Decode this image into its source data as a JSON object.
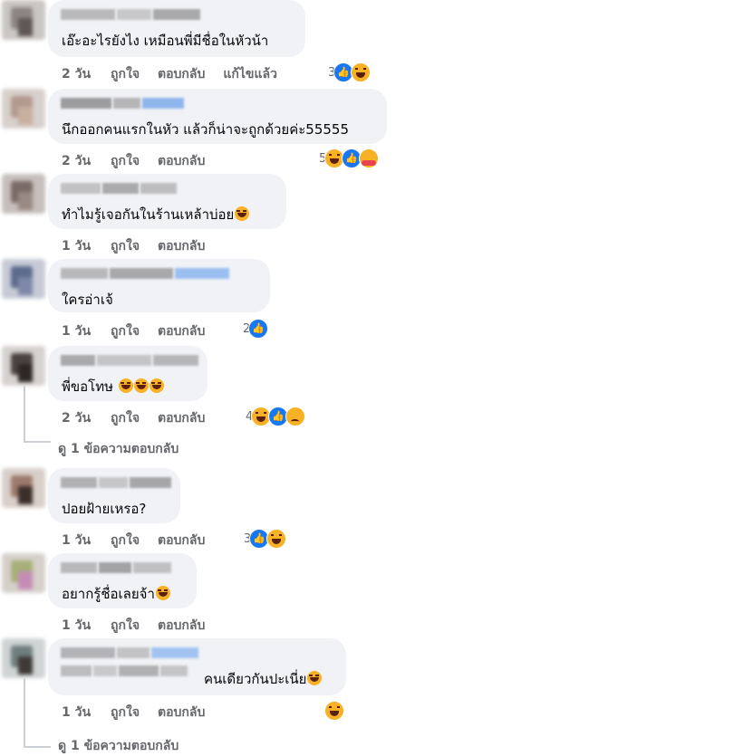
{
  "colors": {
    "bubble": "#f0f2f5",
    "meta": "#65676b",
    "like": "#1877f2",
    "emoji": "#f7b125"
  },
  "comments": [
    {
      "text": "เอ๊ะอะไรยังไง เหมือนพี่มีชื่อในหัวน้า",
      "age": "2 วัน",
      "like": "ถูกใจ",
      "reply": "ตอบกลับ",
      "edited": "แก้ไขแล้ว",
      "reaction_count": "3",
      "reactions": [
        "like",
        "haha"
      ]
    },
    {
      "text": "นึกออกคนแรกในหัว แล้วก็น่าจะถูกด้วยค่ะ55555",
      "age": "2 วัน",
      "like": "ถูกใจ",
      "reply": "ตอบกลับ",
      "reaction_count": "5",
      "reactions": [
        "haha",
        "like",
        "care"
      ]
    },
    {
      "text": "ทำไมรู้เจอกันในร้านเหล้าบ่อย",
      "age": "1 วัน",
      "like": "ถูกใจ",
      "reply": "ตอบกลับ",
      "emoji_icons": [
        "rofl-emoji"
      ]
    },
    {
      "text": "ใครอ่าเจ้",
      "age": "1 วัน",
      "like": "ถูกใจ",
      "reply": "ตอบกลับ",
      "reaction_count": "2",
      "reactions": [
        "like"
      ]
    },
    {
      "text": "พี่ขอโทษ",
      "age": "2 วัน",
      "like": "ถูกใจ",
      "reply": "ตอบกลับ",
      "reaction_count": "4",
      "reactions": [
        "haha",
        "like",
        "sad"
      ],
      "emoji_icons": [
        "rofl-emoji",
        "rofl-emoji",
        "rofl-emoji"
      ],
      "view_replies": "ดู 1 ข้อความตอบกลับ"
    },
    {
      "text": "ปอยฝ้ายเหรอ?",
      "age": "1 วัน",
      "like": "ถูกใจ",
      "reply": "ตอบกลับ",
      "reaction_count": "3",
      "reactions": [
        "like",
        "haha"
      ]
    },
    {
      "text": "อยากรู้ชื่อเลยจ้า",
      "age": "1 วัน",
      "like": "ถูกใจ",
      "reply": "ตอบกลับ",
      "emoji_icons": [
        "laugh-emoji"
      ]
    },
    {
      "text": "คนเดียวกันปะเนี่ย",
      "age": "1 วัน",
      "like": "ถูกใจ",
      "reply": "ตอบกลับ",
      "reactions": [
        "haha"
      ],
      "emoji_icons": [
        "rofl-emoji"
      ],
      "view_replies": "ดู 1 ข้อความตอบกลับ"
    }
  ]
}
